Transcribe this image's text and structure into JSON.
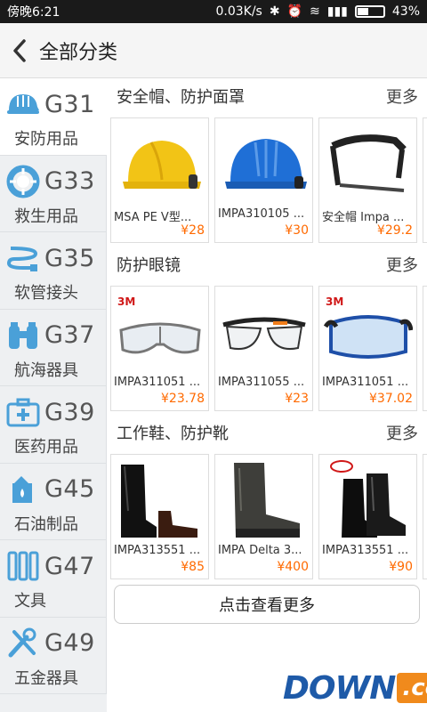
{
  "status_bar": {
    "carrier": "傍晚6:21",
    "speed": "0.03K/s",
    "battery": "43%",
    "battery_level": 0.43
  },
  "header": {
    "title": "全部分类"
  },
  "sidebar": {
    "items": [
      {
        "code": "G31",
        "label": "安防用品",
        "icon": "helmet-icon"
      },
      {
        "code": "G33",
        "label": "救生用品",
        "icon": "lifebuoy-icon"
      },
      {
        "code": "G35",
        "label": "软管接头",
        "icon": "hose-icon"
      },
      {
        "code": "G37",
        "label": "航海器具",
        "icon": "binoculars-icon"
      },
      {
        "code": "G39",
        "label": "医药用品",
        "icon": "first-aid-kit-icon"
      },
      {
        "code": "G45",
        "label": "石油制品",
        "icon": "oil-can-icon"
      },
      {
        "code": "G47",
        "label": "文具",
        "icon": "stationery-icon"
      },
      {
        "code": "G49",
        "label": "五金器具",
        "icon": "tools-icon"
      }
    ]
  },
  "sections": [
    {
      "title": "安全帽、防护面罩",
      "more": "更多",
      "products": [
        {
          "name": "MSA PE V型...",
          "price": "¥28",
          "image": "yellow-helmet-image"
        },
        {
          "name": "IMPA310105 ...",
          "price": "¥30",
          "image": "blue-helmet-image"
        },
        {
          "name": "安全帽 Impa ...",
          "price": "¥29.2",
          "image": "face-shield-bracket-image"
        }
      ]
    },
    {
      "title": "防护眼镜",
      "more": "更多",
      "products": [
        {
          "name": "IMPA311051 ...",
          "price": "¥23.78",
          "image": "safety-glasses-image"
        },
        {
          "name": "IMPA311055 ...",
          "price": "¥23",
          "image": "safety-glasses-orange-image"
        },
        {
          "name": "IMPA311051 ...",
          "price": "¥37.02",
          "image": "safety-goggles-image"
        }
      ]
    },
    {
      "title": "工作鞋、防护靴",
      "more": "更多",
      "products": [
        {
          "name": "IMPA313551 ...",
          "price": "¥85",
          "image": "black-boots-image"
        },
        {
          "name": "IMPA Delta 3...",
          "price": "¥400",
          "image": "grey-boots-image"
        },
        {
          "name": "IMPA313551 ...",
          "price": "¥90",
          "image": "rain-boots-image"
        }
      ]
    }
  ],
  "more_button": "点击查看更多",
  "watermark": {
    "part1": "DOWN",
    "part2": ".cc"
  },
  "colors": {
    "accent": "#4aa0d8",
    "price": "#ff6a00"
  }
}
